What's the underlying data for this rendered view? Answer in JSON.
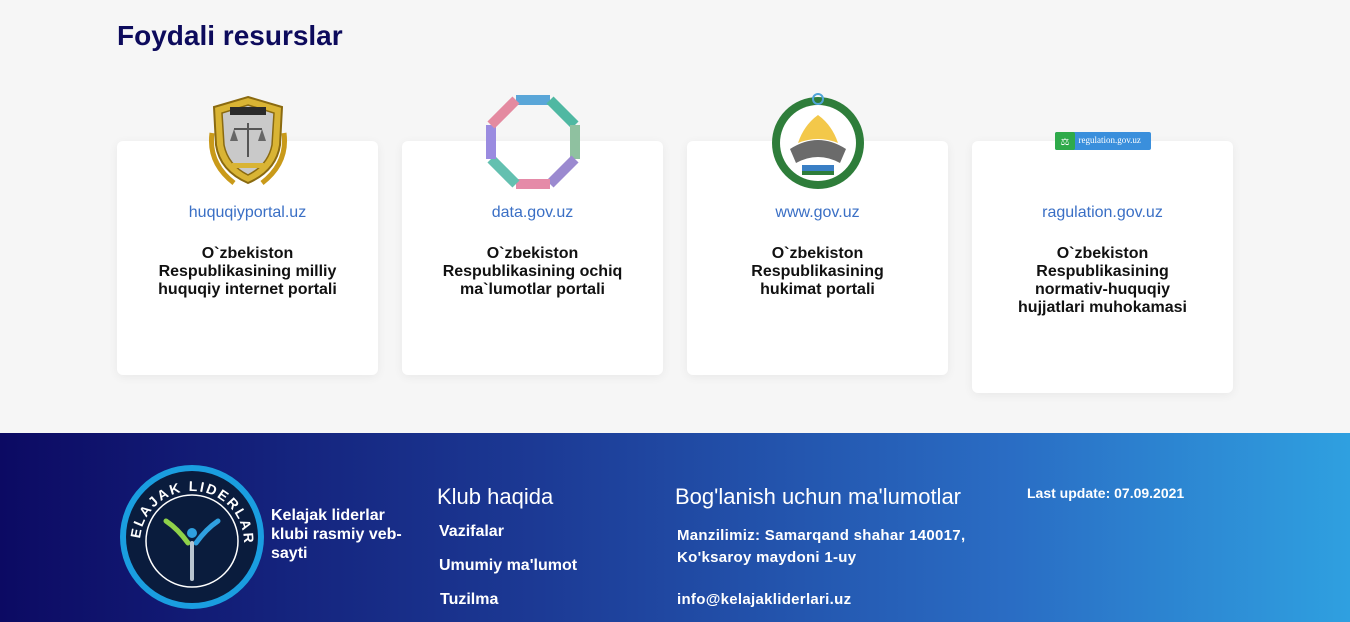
{
  "section": {
    "title": "Foydali resurslar"
  },
  "resources": [
    {
      "link": "huquqiyportal.uz",
      "description": "O`zbekiston Respublikasining milliy huquqiy internet portali",
      "logo_icon": "legal-emblem-icon"
    },
    {
      "link": "data.gov.uz",
      "description": "O`zbekiston Respublikasining ochiq ma`lumotlar portali",
      "logo_icon": "open-data-octagon-icon"
    },
    {
      "link": "www.gov.uz",
      "description": "O`zbekiston Respublikasining hukimat portali",
      "logo_icon": "state-emblem-icon"
    },
    {
      "link": "ragulation.gov.uz",
      "description": "O`zbekiston Respublikasining normativ-huquqiy hujjatlari muhokamasi",
      "logo_icon": "regulation-badge-icon",
      "logo_text": "regulation.gov.uz"
    }
  ],
  "footer": {
    "emblem_text": "KELAJAK LIDERLARI",
    "club_title": "Kelajak liderlar klubi rasmiy veb-sayti",
    "about": {
      "heading": "Klub haqida",
      "links": [
        "Vazifalar",
        "Umumiy ma'lumot",
        "Tuzilma"
      ]
    },
    "contact": {
      "heading": "Bog'lanish uchun ma'lumotlar",
      "address_line1": "Manzilimiz: Samarqand shahar 140017,",
      "address_line2": "Ko'ksaroy maydoni 1-uy",
      "email": "info@kelajakliderlari.uz"
    },
    "last_update": "Last update: 07.09.2021"
  },
  "colors": {
    "title": "#0d0b5c",
    "link": "#3a6fc5",
    "footer_gradient_start": "#0c0a63",
    "footer_gradient_end": "#2fa0e0"
  }
}
